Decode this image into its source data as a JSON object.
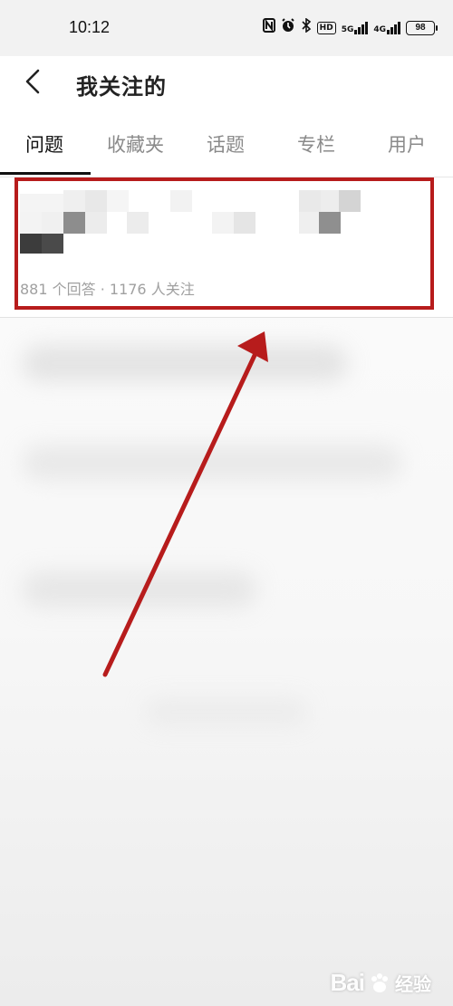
{
  "status_bar": {
    "time": "10:12",
    "nfc_icon": "N",
    "alarm_icon": "alarm-clock",
    "bluetooth_icon": "bluetooth",
    "hd_badge": "HD",
    "net1": "5G",
    "net2": "4G",
    "battery": "98"
  },
  "header": {
    "back_icon": "chevron-left-icon",
    "title": "我关注的"
  },
  "tabs": [
    {
      "label": "问题",
      "active": true
    },
    {
      "label": "收藏夹",
      "active": false
    },
    {
      "label": "话题",
      "active": false
    },
    {
      "label": "专栏",
      "active": false
    },
    {
      "label": "用户",
      "active": false
    }
  ],
  "question": {
    "meta": "881 个回答 · 1176 人关注"
  },
  "annotation": {
    "highlight_color": "#b71c1c",
    "arrow_color": "#b71c1c"
  },
  "watermark": {
    "logo": "Bai",
    "text": "经验"
  }
}
